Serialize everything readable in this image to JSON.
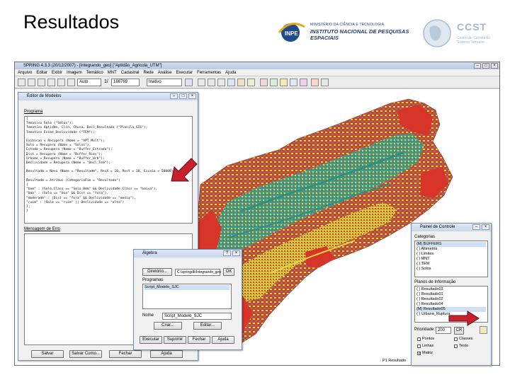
{
  "slide": {
    "title": "Resultados"
  },
  "logos": {
    "inpe_line1": "MINISTÉRIO DA CIÊNCIA E TECNOLOGIA",
    "inpe_line2": "INSTITUTO NACIONAL DE PESQUISAS ESPACIAIS",
    "ccst_big": "CCST",
    "ccst_small": "Centro de Ciência do Sistema Terrestre"
  },
  "app": {
    "title": "SPRING 4.3.3 (20/12/2007) - [Integrando_geo] [\"Aptidão_Agricola_UTM\"]",
    "menu": [
      "Arquivo",
      "Editar",
      "Exibir",
      "Imagem",
      "Temático",
      "MNT",
      "Cadastral",
      "Rede",
      "Análise",
      "Executar",
      "Ferramentas",
      "Ajuda"
    ],
    "toolbar": {
      "zoom_mode": "Auto",
      "scale_prefix": "1/",
      "scale_value": "186769",
      "display_mode": "Inativo"
    }
  },
  "editor": {
    "title": "Editor de Modelos",
    "program_label": "Programa",
    "program_text": "{\nTematico Solo (\"Solos\");\nTematico Aptidão, Clin, Chuva, Decl_Resultado (\"Planila_GIS\");\nTematico Exibe_Declividade (\"TEM\");\n\nExibicao = Recupera (Nome = \"APT_Mult\");\nSolo = Recupera (Nome = \"Solos\");\nEstado = Recupera (Nome = \"Buffer_Estrada\");\nDist = Recupera (Nome = \"Buffer_Rios\");\nUrbano = Recupera (Nome = \"Buffer_Urb\");\nDeclividade = Recupera (Nome = \"Decl_Tem\");\n\nResultado = Novo (Nome = \"Resultado\", ResX = 10, ResY = 10, Escala = 50000);\n\nResultado = Atribui (CategoriaFim = \"Resultado\")\n{\n\"bom\" : (Solo.Class == \"Solo_Bom\" && Declividade.Class == \"baixa\"),\n\"boa\" : (Solo == \"boa\" && Dist == \"fora\"),\n\"moderado\" : (Dist == \"fora\" && Declividade == \"media\"),\n\"ruim\" : (Solo == \"ruim\" || Declividade == \"alta\")\n};\n}",
    "messages_label": "Mensagem de Erro",
    "buttons": [
      "Salvar",
      "Salvar Como...",
      "Fechar",
      "Ajuda"
    ]
  },
  "algebra": {
    "title": "Álgebra",
    "dir_button": "Diretório...",
    "dir_field": "C:\\springdb\\Integrando_geo",
    "dir_ok": "OK",
    "programs_label": "Programas",
    "programs": [
      "Script_Modelo_SJC"
    ],
    "name_label": "Nome",
    "name_value": "Script_Modelo_SJC",
    "create_button": "Criar...",
    "edit_button": "Editar...",
    "bottom_buttons": [
      "Executar",
      "Suprimir",
      "Fechar",
      "Ajuda"
    ]
  },
  "painel": {
    "title": "Painel de Controle",
    "categories_label": "Categorias",
    "categories": [
      "(M) BUFFERS",
      "( ) Altimetria",
      "( ) Limites",
      "( ) MNT",
      "( ) TEM",
      "( ) Solos"
    ],
    "planes_label": "Planos de Informação",
    "planes": [
      "( ) Resultado03",
      "( ) Resultado01",
      "( ) Resultado02",
      "( ) Resultado04",
      "(M) Resultado05",
      "( ) Urbano_Ruptura"
    ],
    "priority_label": "Prioridade:",
    "priority_value": "200",
    "priority_button": "CR",
    "checks": [
      {
        "label": "Pontos",
        "checked": false
      },
      {
        "label": "Linhas",
        "checked": false
      },
      {
        "label": "Matriz",
        "checked": true
      },
      {
        "label": "Classes",
        "checked": false
      },
      {
        "label": "Texto",
        "checked": false
      }
    ],
    "status_text": "P1 Resultado"
  }
}
